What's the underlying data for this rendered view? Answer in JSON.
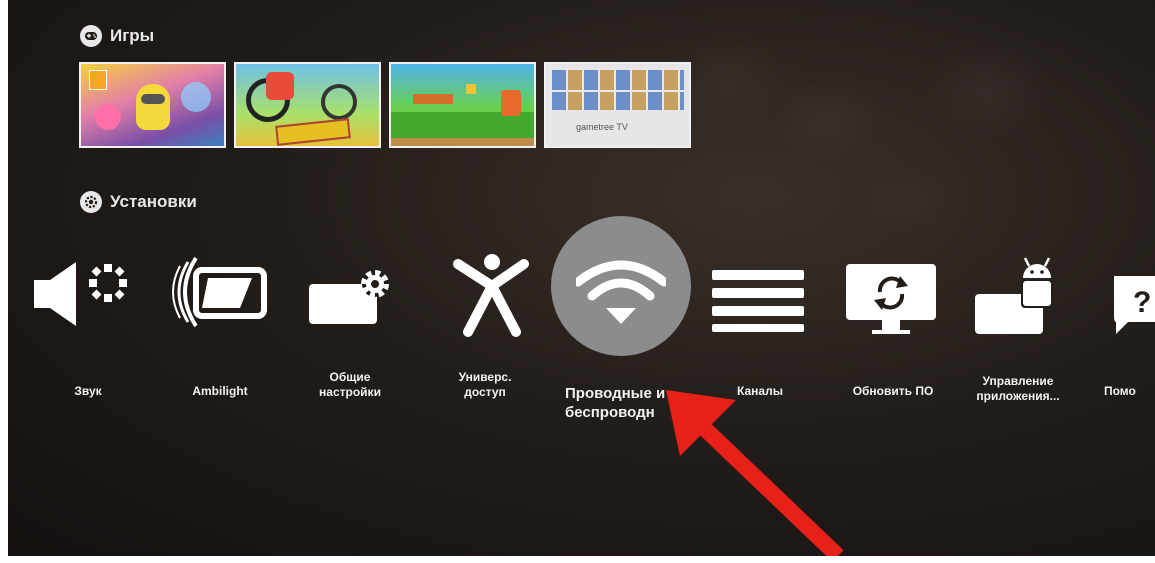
{
  "sections": {
    "games": {
      "title": "Игры",
      "icon": "gamepad-icon"
    },
    "settings": {
      "title": "Установки",
      "icon": "gear-icon"
    }
  },
  "games": [
    {
      "name": "game-tile-1",
      "caption": ""
    },
    {
      "name": "game-tile-2",
      "caption": ""
    },
    {
      "name": "game-tile-3",
      "caption": ""
    },
    {
      "name": "game-tile-4",
      "caption": "gametree TV"
    }
  ],
  "settings_items": [
    {
      "id": "sound",
      "label": "Звук",
      "icon": "speaker-icon"
    },
    {
      "id": "ambilight",
      "label": "Ambilight",
      "icon": "ambilight-icon"
    },
    {
      "id": "general",
      "label": "Общие настройки",
      "icon": "general-settings-icon"
    },
    {
      "id": "accessibility",
      "label": "Универс. доступ",
      "icon": "accessibility-icon"
    },
    {
      "id": "network",
      "label": "Проводные и беспроводн",
      "icon": "wifi-icon",
      "selected": true
    },
    {
      "id": "channels",
      "label": "Каналы",
      "icon": "channels-icon"
    },
    {
      "id": "update",
      "label": "Обновить ПО",
      "icon": "update-software-icon"
    },
    {
      "id": "apps",
      "label": "Управление приложения...",
      "icon": "android-apps-icon"
    },
    {
      "id": "help",
      "label": "Помо",
      "icon": "help-icon"
    }
  ],
  "colors": {
    "background": "#231d19",
    "selected_highlight": "#8c8c8c",
    "icon": "#ffffff",
    "arrow": "#e8201a"
  }
}
